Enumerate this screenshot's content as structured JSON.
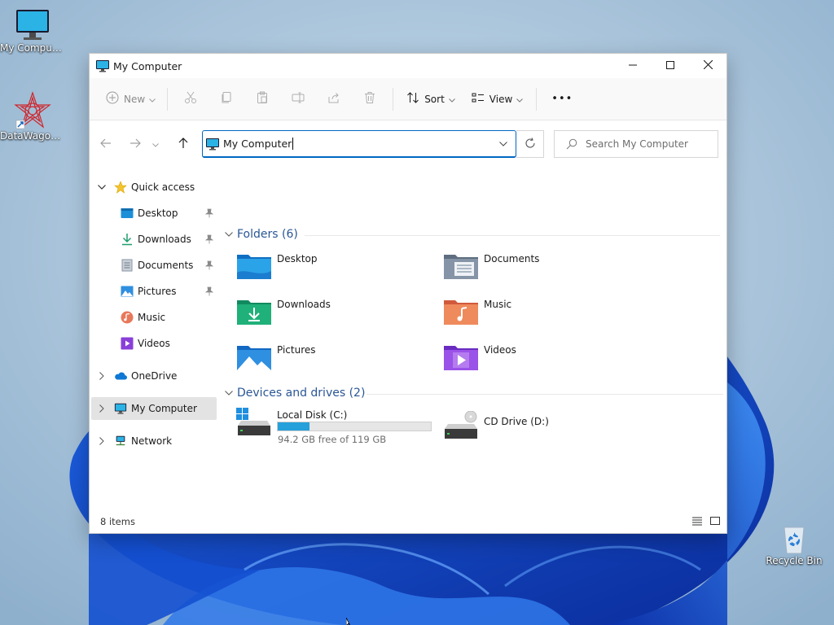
{
  "desktop": {
    "icons": [
      {
        "label": "My Computer"
      },
      {
        "label": "DataWagon..."
      },
      {
        "label": "Recycle Bin"
      }
    ]
  },
  "window": {
    "title": "My Computer",
    "controls": {
      "minimize": "minimize",
      "maximize": "maximize",
      "close": "close"
    }
  },
  "toolbar": {
    "new_label": "New",
    "sort_label": "Sort",
    "view_label": "View",
    "more_label": "•••"
  },
  "navbar": {
    "address": "My Computer",
    "search_placeholder": "Search My Computer"
  },
  "sidebar": {
    "quick_access": "Quick access",
    "items": [
      {
        "label": "Desktop",
        "pinned": true
      },
      {
        "label": "Downloads",
        "pinned": true
      },
      {
        "label": "Documents",
        "pinned": true
      },
      {
        "label": "Pictures",
        "pinned": true
      },
      {
        "label": "Music",
        "pinned": false
      },
      {
        "label": "Videos",
        "pinned": false
      }
    ],
    "onedrive": "OneDrive",
    "my_computer": "My Computer",
    "network": "Network"
  },
  "content": {
    "folders_title": "Folders (6)",
    "folders": [
      {
        "label": "Desktop"
      },
      {
        "label": "Documents"
      },
      {
        "label": "Downloads"
      },
      {
        "label": "Music"
      },
      {
        "label": "Pictures"
      },
      {
        "label": "Videos"
      }
    ],
    "drives_title": "Devices and drives (2)",
    "drives": [
      {
        "label": "Local Disk (C:)",
        "free_text": "94.2 GB free of 119 GB",
        "used_fraction": 0.21
      },
      {
        "label": "CD Drive (D:)"
      }
    ]
  },
  "status": {
    "items_text": "8 items"
  },
  "colors": {
    "accent": "#0067c0",
    "section_title": "#2a5696",
    "drive_fill": "#26a0da"
  }
}
